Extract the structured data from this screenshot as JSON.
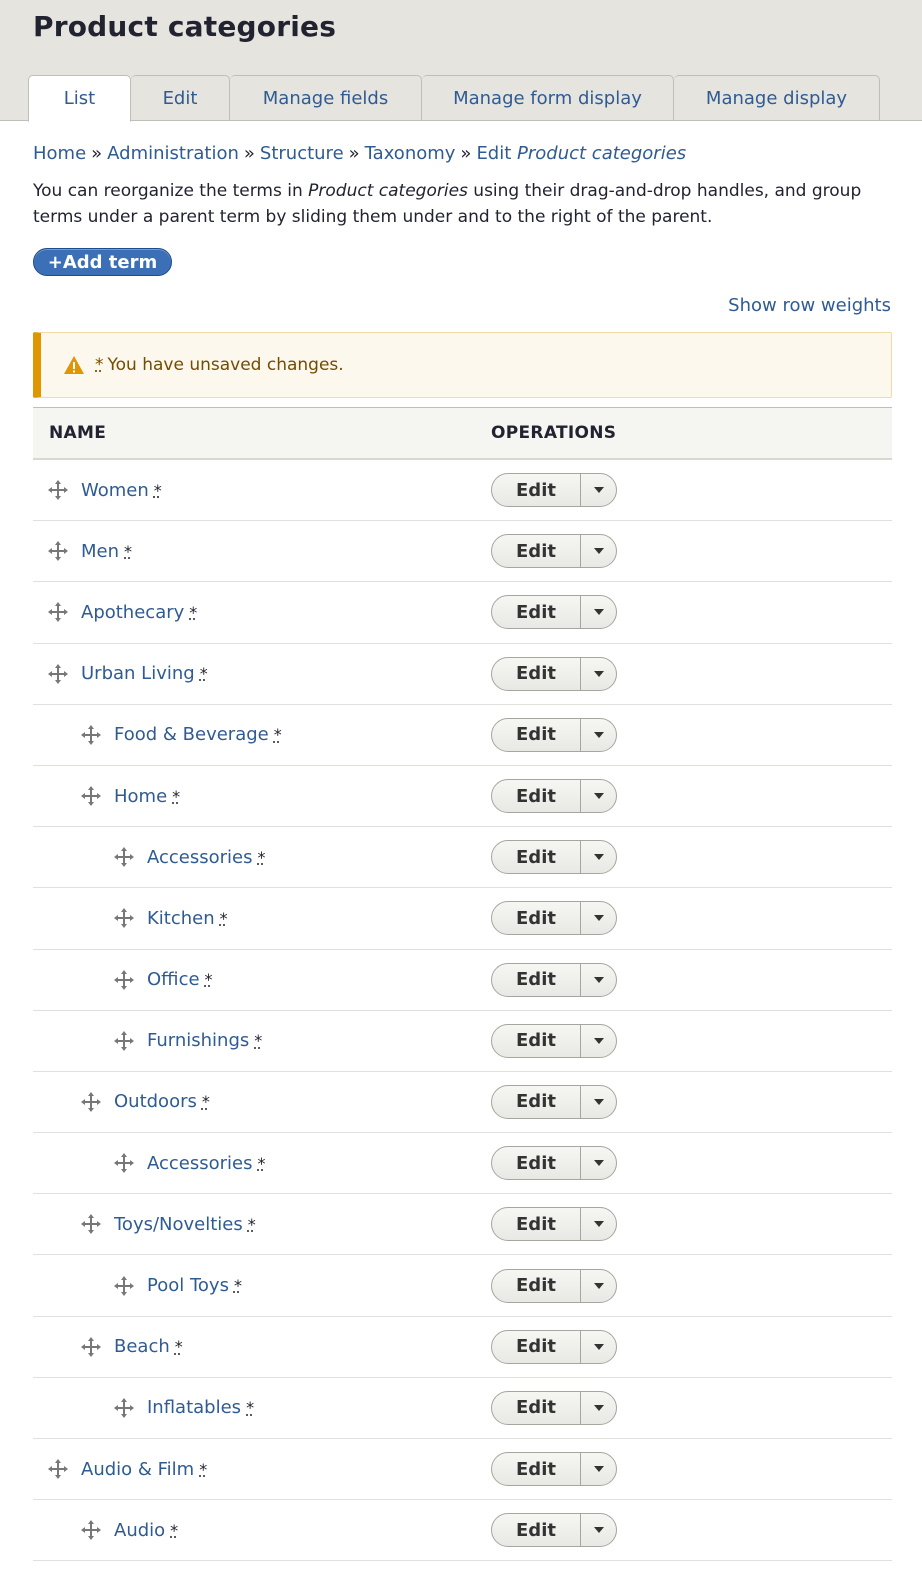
{
  "header": {
    "title": "Product categories",
    "tabs": [
      {
        "label": "List",
        "active": true
      },
      {
        "label": "Edit",
        "active": false
      },
      {
        "label": "Manage fields",
        "active": false
      },
      {
        "label": "Manage form display",
        "active": false
      },
      {
        "label": "Manage display",
        "active": false
      }
    ]
  },
  "breadcrumb": {
    "home": "Home",
    "administration": "Administration",
    "structure": "Structure",
    "taxonomy": "Taxonomy",
    "edit_prefix": "Edit",
    "edit_vocab": "Product categories",
    "separator": "»"
  },
  "description": {
    "part1": "You can reorganize the terms in ",
    "vocab": "Product categories",
    "part2": " using their drag-and-drop handles, and group terms under a parent term by sliding them under and to the right of the parent."
  },
  "add_term": "+Add term",
  "show_row_weights": "Show row weights",
  "warning": {
    "star": "*",
    "message": "You have unsaved changes.",
    "color": "#e09600"
  },
  "table": {
    "col_name": "NAME",
    "col_operations": "OPERATIONS",
    "changed_marker": "*",
    "edit_label": "Edit",
    "rows": [
      {
        "name": "Women",
        "depth": 0
      },
      {
        "name": "Men",
        "depth": 0
      },
      {
        "name": "Apothecary",
        "depth": 0
      },
      {
        "name": "Urban Living",
        "depth": 0
      },
      {
        "name": "Food & Beverage",
        "depth": 1
      },
      {
        "name": "Home",
        "depth": 1
      },
      {
        "name": "Accessories",
        "depth": 2
      },
      {
        "name": "Kitchen",
        "depth": 2
      },
      {
        "name": "Office",
        "depth": 2
      },
      {
        "name": "Furnishings",
        "depth": 2
      },
      {
        "name": "Outdoors",
        "depth": 1
      },
      {
        "name": "Accessories",
        "depth": 2
      },
      {
        "name": "Toys/Novelties",
        "depth": 1
      },
      {
        "name": "Pool Toys",
        "depth": 2
      },
      {
        "name": "Beach",
        "depth": 1
      },
      {
        "name": "Inflatables",
        "depth": 2
      },
      {
        "name": "Audio & Film",
        "depth": 0
      },
      {
        "name": "Audio",
        "depth": 1
      }
    ]
  },
  "colors": {
    "link": "#2f5b93",
    "primary_button": "#3b6fb6",
    "header_bg": "#e6e4df"
  }
}
